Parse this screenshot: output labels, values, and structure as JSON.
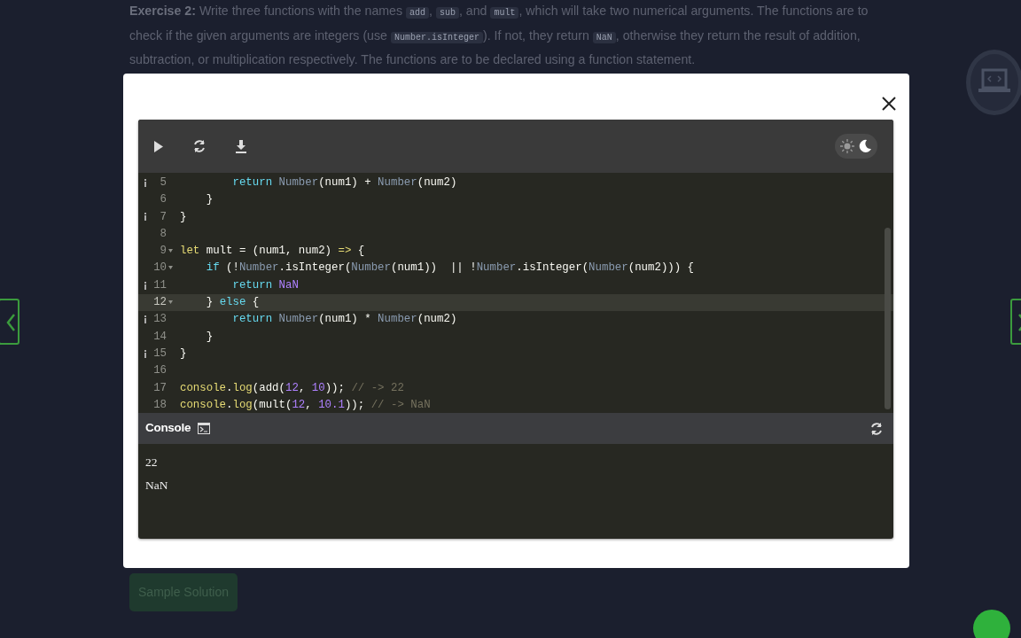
{
  "exercise": {
    "segments": [
      {
        "kind": "bold",
        "text": "Exercise 2:"
      },
      {
        "kind": "text",
        "text": " Write three functions with the names "
      },
      {
        "kind": "code",
        "text": "add"
      },
      {
        "kind": "text",
        "text": ", "
      },
      {
        "kind": "code",
        "text": "sub"
      },
      {
        "kind": "text",
        "text": ", and "
      },
      {
        "kind": "code",
        "text": "mult"
      },
      {
        "kind": "text",
        "text": ", which will take two numerical arguments. The functions are to check if the given arguments are integers (use "
      },
      {
        "kind": "code",
        "text": "Number.isInteger"
      },
      {
        "kind": "text",
        "text": "). If not, they return "
      },
      {
        "kind": "code",
        "text": "NaN"
      },
      {
        "kind": "text",
        "text": ", otherwise they return the result of addition, subtraction, or multiplication respectively. The functions are to be declared using a function statement."
      }
    ]
  },
  "editor": {
    "theme_dark": true,
    "lines": [
      {
        "number": "5",
        "info": true,
        "fold": false,
        "active": false,
        "tokens": [
          {
            "kind": "keyword",
            "t": "        return "
          },
          {
            "kind": "builtin",
            "t": "Number"
          },
          {
            "kind": "plain",
            "t": "(num1) + "
          },
          {
            "kind": "builtin",
            "t": "Number"
          },
          {
            "kind": "plain",
            "t": "(num2)"
          }
        ]
      },
      {
        "number": "6",
        "info": false,
        "fold": false,
        "active": false,
        "tokens": [
          {
            "kind": "plain",
            "t": "    }"
          }
        ]
      },
      {
        "number": "7",
        "info": true,
        "fold": false,
        "active": false,
        "tokens": [
          {
            "kind": "plain",
            "t": "}"
          }
        ]
      },
      {
        "number": "8",
        "info": false,
        "fold": false,
        "active": false
      },
      {
        "number": "9",
        "info": false,
        "fold": true,
        "active": false,
        "tokens": [
          {
            "kind": "storage",
            "t": "let"
          },
          {
            "kind": "plain",
            "t": " mult = (num1, num2) "
          },
          {
            "kind": "storage",
            "t": "=>"
          },
          {
            "kind": "plain",
            "t": " {"
          }
        ]
      },
      {
        "number": "10",
        "info": false,
        "fold": true,
        "active": false,
        "tokens": [
          {
            "kind": "keyword",
            "t": "    if"
          },
          {
            "kind": "plain",
            "t": " (!"
          },
          {
            "kind": "builtin",
            "t": "Number"
          },
          {
            "kind": "plain",
            "t": ".isInteger("
          },
          {
            "kind": "builtin",
            "t": "Number"
          },
          {
            "kind": "plain",
            "t": "(num1))  || !"
          },
          {
            "kind": "builtin",
            "t": "Number"
          },
          {
            "kind": "plain",
            "t": ".isInteger("
          },
          {
            "kind": "builtin",
            "t": "Number"
          },
          {
            "kind": "plain",
            "t": "(num2))) {"
          }
        ]
      },
      {
        "number": "11",
        "info": true,
        "fold": false,
        "active": false,
        "tokens": [
          {
            "kind": "keyword",
            "t": "        return "
          },
          {
            "kind": "constant",
            "t": "NaN"
          }
        ]
      },
      {
        "number": "12",
        "info": false,
        "fold": true,
        "active": true,
        "tokens": [
          {
            "kind": "plain",
            "t": "    } "
          },
          {
            "kind": "keyword",
            "t": "else"
          },
          {
            "kind": "plain",
            "t": " {"
          }
        ]
      },
      {
        "number": "13",
        "info": true,
        "fold": false,
        "active": false,
        "tokens": [
          {
            "kind": "keyword",
            "t": "        return "
          },
          {
            "kind": "builtin",
            "t": "Number"
          },
          {
            "kind": "plain",
            "t": "(num1) * "
          },
          {
            "kind": "builtin",
            "t": "Number"
          },
          {
            "kind": "plain",
            "t": "(num2)"
          }
        ]
      },
      {
        "number": "14",
        "info": false,
        "fold": false,
        "active": false,
        "tokens": [
          {
            "kind": "plain",
            "t": "    }"
          }
        ]
      },
      {
        "number": "15",
        "info": true,
        "fold": false,
        "active": false,
        "tokens": [
          {
            "kind": "plain",
            "t": "}"
          }
        ]
      },
      {
        "number": "16",
        "info": false,
        "fold": false,
        "active": false
      },
      {
        "number": "17",
        "info": false,
        "fold": false,
        "active": false,
        "tokens": [
          {
            "kind": "storage",
            "t": "console"
          },
          {
            "kind": "plain",
            "t": "."
          },
          {
            "kind": "storage",
            "t": "log"
          },
          {
            "kind": "plain",
            "t": "(add("
          },
          {
            "kind": "constant",
            "t": "12"
          },
          {
            "kind": "plain",
            "t": ", "
          },
          {
            "kind": "constant",
            "t": "10"
          },
          {
            "kind": "plain",
            "t": ")); "
          },
          {
            "kind": "comment",
            "t": "// -> 22"
          }
        ]
      },
      {
        "number": "18",
        "info": false,
        "fold": false,
        "active": false,
        "tokens": [
          {
            "kind": "storage",
            "t": "console"
          },
          {
            "kind": "plain",
            "t": "."
          },
          {
            "kind": "storage",
            "t": "log"
          },
          {
            "kind": "plain",
            "t": "(mult("
          },
          {
            "kind": "constant",
            "t": "12"
          },
          {
            "kind": "plain",
            "t": ", "
          },
          {
            "kind": "constant",
            "t": "10.1"
          },
          {
            "kind": "plain",
            "t": ")); "
          },
          {
            "kind": "comment",
            "t": "// -> NaN"
          }
        ]
      }
    ]
  },
  "console": {
    "title": "Console",
    "output": [
      "22",
      "NaN"
    ]
  },
  "sample_solution_button": "Sample Solution"
}
